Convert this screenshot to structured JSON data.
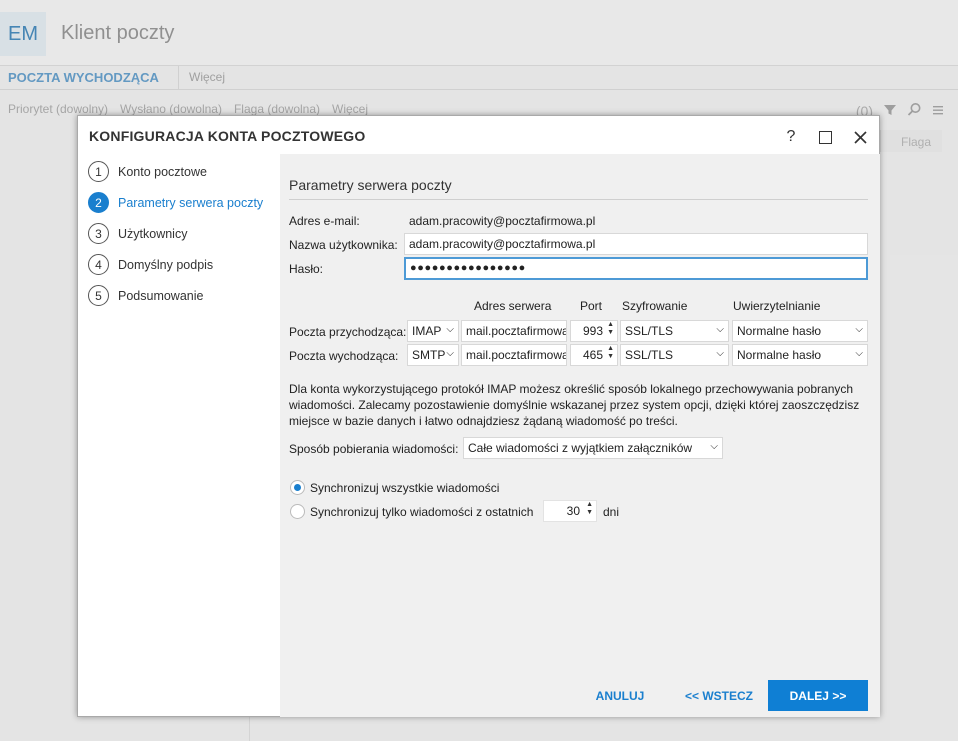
{
  "app": {
    "logo": "EM",
    "title": "Klient poczty",
    "tabs": [
      "POCZTA WYCHODZĄCA",
      "Więcej"
    ],
    "filters": [
      "Priorytet (dowolny)",
      "Wysłano (dowolna)",
      "Flaga (dowolna)",
      "Więcej"
    ],
    "tools_label": "(0)",
    "column_header": "Flaga"
  },
  "dialog": {
    "title": "KONFIGURACJA KONTA POCZTOWEGO",
    "help": "?",
    "close": "✕",
    "steps": [
      {
        "num": "1",
        "label": "Konto pocztowe"
      },
      {
        "num": "2",
        "label": "Parametry serwera poczty",
        "active": true
      },
      {
        "num": "3",
        "label": "Użytkownicy"
      },
      {
        "num": "4",
        "label": "Domyślny podpis"
      },
      {
        "num": "5",
        "label": "Podsumowanie"
      }
    ],
    "section_title": "Parametry serwera poczty",
    "email_label": "Adres e-mail:",
    "email_value": "adam.pracowity@pocztafirmowa.pl",
    "username_label": "Nazwa użytkownika:",
    "username_value": "adam.pracowity@pocztafirmowa.pl",
    "password_label": "Hasło:",
    "password_value": "●●●●●●●●●●●●●●●●",
    "server_headers": {
      "address": "Adres serwera",
      "port": "Port",
      "encryption": "Szyfrowanie",
      "auth": "Uwierzytelnianie"
    },
    "incoming": {
      "label": "Poczta przychodząca:",
      "protocol": "IMAP",
      "server": "mail.pocztafirmowa.pl",
      "port": "993",
      "encryption": "SSL/TLS",
      "auth": "Normalne hasło"
    },
    "outgoing": {
      "label": "Poczta wychodząca:",
      "protocol": "SMTP",
      "server": "mail.pocztafirmowa.pl",
      "port": "465",
      "encryption": "SSL/TLS",
      "auth": "Normalne hasło"
    },
    "info_text": "Dla konta wykorzystującego protokół IMAP możesz określić sposób lokalnego przechowywania pobranych wiadomości. Zalecamy pozostawienie domyślnie wskazanej przez system opcji, dzięki której zaoszczędzisz miejsce w bazie danych i łatwo odnajdziesz żądaną wiadomość po treści.",
    "download_label": "Sposób pobierania wiadomości:",
    "download_value": "Całe wiadomości z wyjątkiem załączników",
    "sync_all_label": "Synchronizuj wszystkie wiadomości",
    "sync_all_checked": true,
    "sync_recent_label": "Synchronizuj tylko wiadomości z ostatnich",
    "sync_recent_checked": false,
    "sync_days": "30",
    "sync_days_unit": "dni",
    "buttons": {
      "cancel": "ANULUJ",
      "back": "<< WSTECZ",
      "next": "DALEJ >>"
    }
  }
}
